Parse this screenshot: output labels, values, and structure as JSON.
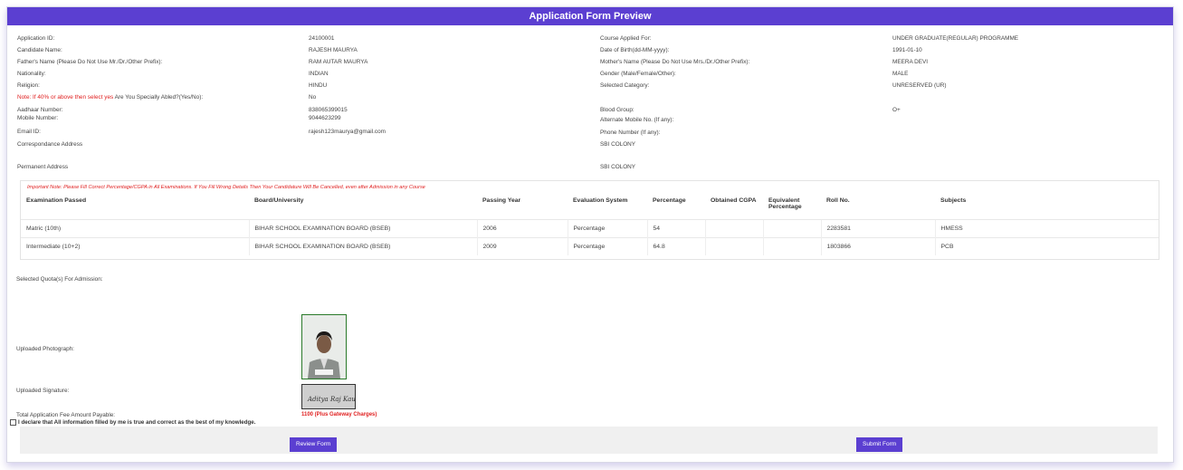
{
  "title": "Application Form Preview",
  "info": {
    "app_id_label": "Application ID:",
    "app_id": "24100001",
    "course_label": "Course Applied For:",
    "course": "UNDER GRADUATE(REGULAR) PROGRAMME",
    "name_label": "Candidate Name:",
    "name": "RAJESH MAURYA",
    "dob_label": "Date of Birth(dd-MM-yyyy):",
    "dob": "1991-01-10",
    "father_label": "Father's Name (Please Do Not Use Mr./Dr./Other Prefix):",
    "father": "RAM AUTAR MAURYA",
    "mother_label": "Mother's Name (Please Do Not Use Mrs./Dr./Other Prefix):",
    "mother": "MEERA DEVI",
    "nationality_label": "Nationality:",
    "nationality": "INDIAN",
    "gender_label": "Gender (Male/Female/Other):",
    "gender": "MALE",
    "religion_label": "Religion:",
    "religion": "HINDU",
    "category_label": "Selected Category:",
    "category": "UNRESERVED (UR)",
    "abled_note": "Note: If 40% or above then select yes",
    "abled_label": " Are You Specially Abled?(Yes/No):",
    "abled": "No",
    "aadhaar_label": "Aadhaar Number:",
    "aadhaar": "838065399015",
    "blood_label": "Blood Group:",
    "blood": "O+",
    "mobile_label": "Mobile Number:",
    "mobile": "9044623299",
    "alt_mobile_label": "Alternate Mobile No. (If any):",
    "email_label": "Email ID:",
    "email": "rajesh123maurya@gmail.com",
    "phone_label": "Phone Number (If any):",
    "corr_label": "Correspondance Address",
    "corr": "SBI COLONY",
    "perm_label": "Permanent Address",
    "perm": "SBI COLONY"
  },
  "exam": {
    "note": "Important Note: Please Fill Correct Percentage/CGPA in All Examinations. If You Fill Wrong Details Then Your Candidature Will Be Cancelled, even after Admission in any Course",
    "headers": [
      "Examination Passed",
      "Board/University",
      "Passing Year",
      "Evaluation System",
      "Percentage",
      "Obtained CGPA",
      "Equivalent Percentage",
      "Roll No.",
      "Subjects"
    ],
    "rows": [
      [
        "Matric (10th)",
        "BIHAR SCHOOL EXAMINATION BOARD (BSEB)",
        "2006",
        "Percentage",
        "54",
        "",
        "",
        "2283581",
        "HMESS"
      ],
      [
        "Intermediate (10+2)",
        "BIHAR SCHOOL EXAMINATION BOARD (BSEB)",
        "2009",
        "Percentage",
        "64.8",
        "",
        "",
        "1803866",
        "PCB"
      ]
    ]
  },
  "quota_label": "Selected Quota(s) For Admission:",
  "photo_label": "Uploaded Photograph:",
  "signature_label": "Uploaded Signature:",
  "signature_text": "Aditya Raj Kaushik",
  "fee_label": "Total Application Fee Amount Payable:",
  "fee": "1100 (Plus Gateway Charges)",
  "declaration": "I declare that All information filled by me is true and correct as the best of my knowledge.",
  "buttons": {
    "review": "Review Form",
    "submit": "Submit Form"
  },
  "colors": {
    "accent": "#5b3fd1",
    "warning": "#e02020"
  }
}
